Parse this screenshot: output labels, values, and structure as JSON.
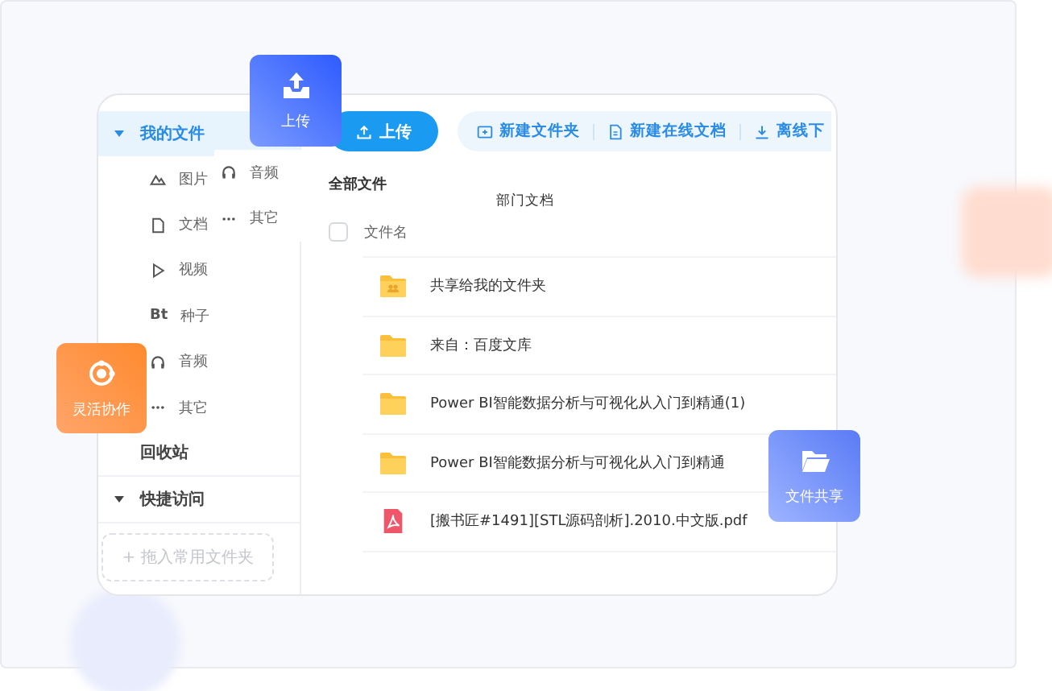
{
  "sidebar": {
    "items": [
      {
        "label": "我的文件",
        "selected": true,
        "expanded": true,
        "children": [
          {
            "label": "图片",
            "kind": "image"
          },
          {
            "label": "文档",
            "kind": "doc"
          },
          {
            "label": "视频",
            "kind": "video"
          },
          {
            "label": "种子",
            "kind": "torrent",
            "glyph": "Bt"
          },
          {
            "label": "音频",
            "kind": "audio"
          },
          {
            "label": "其它",
            "kind": "other"
          }
        ]
      },
      {
        "label": "回收站",
        "selected": false
      },
      {
        "label": "快捷访问",
        "selected": false,
        "expanded": true
      }
    ],
    "drop_zone": "+ 拖入常用文件夹",
    "submenu": [
      {
        "label": "音频",
        "kind": "audio"
      },
      {
        "label": "其它",
        "kind": "other"
      }
    ]
  },
  "toolbar": {
    "upload": "上传",
    "actions": [
      {
        "label": "新建文件夹",
        "kind": "folder"
      },
      {
        "label": "新建在线文档",
        "kind": "doc"
      },
      {
        "label": "离线下",
        "kind": "download"
      }
    ]
  },
  "breadcrumb": "全部文件",
  "tooltip": "部门文档",
  "table": {
    "select_all": {
      "checked": false
    },
    "columns": [
      "文件名"
    ],
    "rows": [
      {
        "name": "共享给我的文件夹",
        "kind": "shared-folder"
      },
      {
        "name": "来自：百度文库",
        "kind": "folder"
      },
      {
        "name": "Power BI智能数据分析与可视化从入门到精通(1)",
        "kind": "folder"
      },
      {
        "name": "Power BI智能数据分析与可视化从入门到精通",
        "kind": "folder"
      },
      {
        "name": "[搬书匠#1491][STL源码剖析].2010.中文版.pdf",
        "kind": "pdf"
      }
    ]
  },
  "tiles": [
    {
      "label": "上传",
      "kind": "upload"
    },
    {
      "label": "灵活协作",
      "kind": "collab"
    },
    {
      "label": "文件共享",
      "kind": "share"
    }
  ]
}
